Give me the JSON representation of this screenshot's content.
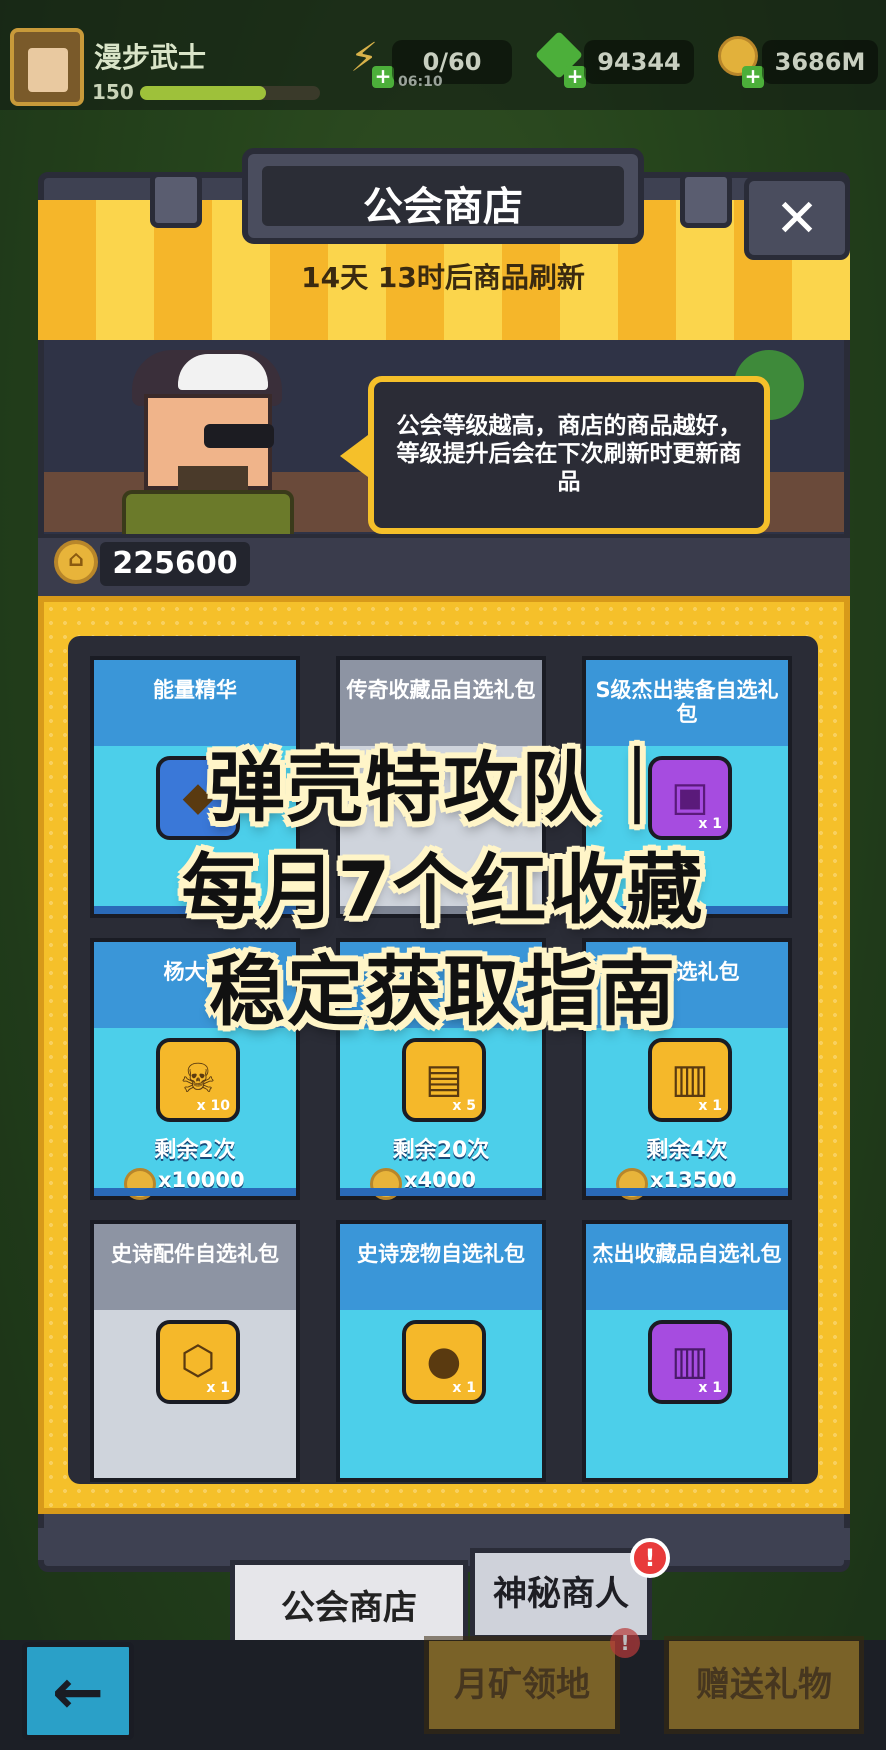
{
  "top_bar": {
    "player_name": "漫步武士",
    "player_level": "150",
    "stamina": "0/60",
    "stamina_timer": "06:10",
    "gems": "94344",
    "coins": "3686M"
  },
  "shop": {
    "title": "公会商店",
    "refresh_notice": "14天 13时后商品刷新",
    "npc_message": "公会等级越高，商店的商品越好，等级提升后会在下次刷新时更新商品",
    "guild_coins": "225600",
    "close_label": "✕",
    "items": [
      {
        "title": "能量精华",
        "remaining": "",
        "price": "",
        "qty": "",
        "style": "blue-card"
      },
      {
        "title": "传奇收藏品自选礼包",
        "remaining": "",
        "price": "",
        "qty": "",
        "style": "grey-card"
      },
      {
        "title": "S级杰出装备自选礼包",
        "remaining": "",
        "price": "",
        "qty": "x 1",
        "style": "blue-card"
      },
      {
        "title": "杨大师",
        "remaining": "剩余2次",
        "price": "x10000",
        "qty": "x 10",
        "style": "blue-card"
      },
      {
        "title": "",
        "remaining": "剩余20次",
        "price": "x4000",
        "qty": "x 5",
        "style": "blue-card"
      },
      {
        "title": "品自选礼包",
        "remaining": "剩余4次",
        "price": "x13500",
        "qty": "x 1",
        "style": "blue-card"
      },
      {
        "title": "史诗配件自选礼包",
        "remaining": "",
        "price": "",
        "qty": "x 1",
        "style": "grey-card"
      },
      {
        "title": "史诗宠物自选礼包",
        "remaining": "",
        "price": "",
        "qty": "x 1",
        "style": "blue-card"
      },
      {
        "title": "杰出收藏品自选礼包",
        "remaining": "",
        "price": "",
        "qty": "x 1",
        "style": "blue-card"
      }
    ]
  },
  "overlay": {
    "line1": "弹壳特攻队｜",
    "line2": "每月7个红收藏",
    "line3": "稳定获取指南"
  },
  "tabs": {
    "guild_shop": "公会商店",
    "mystery_merchant": "神秘商人",
    "badge": "!"
  },
  "bottom_nav": {
    "back": "←",
    "mine": "月矿领地",
    "gift": "赠送礼物",
    "badge": "!"
  }
}
